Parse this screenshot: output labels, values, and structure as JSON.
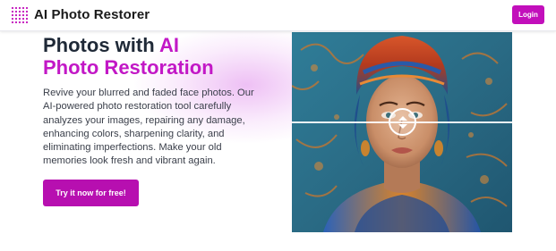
{
  "header": {
    "brand": "AI Photo Restorer",
    "login_label": "Login",
    "logo_icon": "dot-grid-icon",
    "accent_color": "#c20fbb"
  },
  "hero": {
    "heading_line1_plain": "Photos with ",
    "heading_line1_accent": "AI",
    "heading_line2_accent": "Photo Restoration",
    "description": "Revive your blurred and faded face photos. Our AI-powered photo restoration tool carefully analyzes your images, repairing any damage, enhancing colors, sharpening clarity, and eliminating imperfections. Make your old memories look fresh and vibrant again.",
    "cta_label": "Try it now for free!",
    "accent_color": "#c218c6"
  },
  "comparison": {
    "image_subject": "woman-with-colorful-headscarf-portrait",
    "handle_icon": "up-down-arrows-icon"
  }
}
